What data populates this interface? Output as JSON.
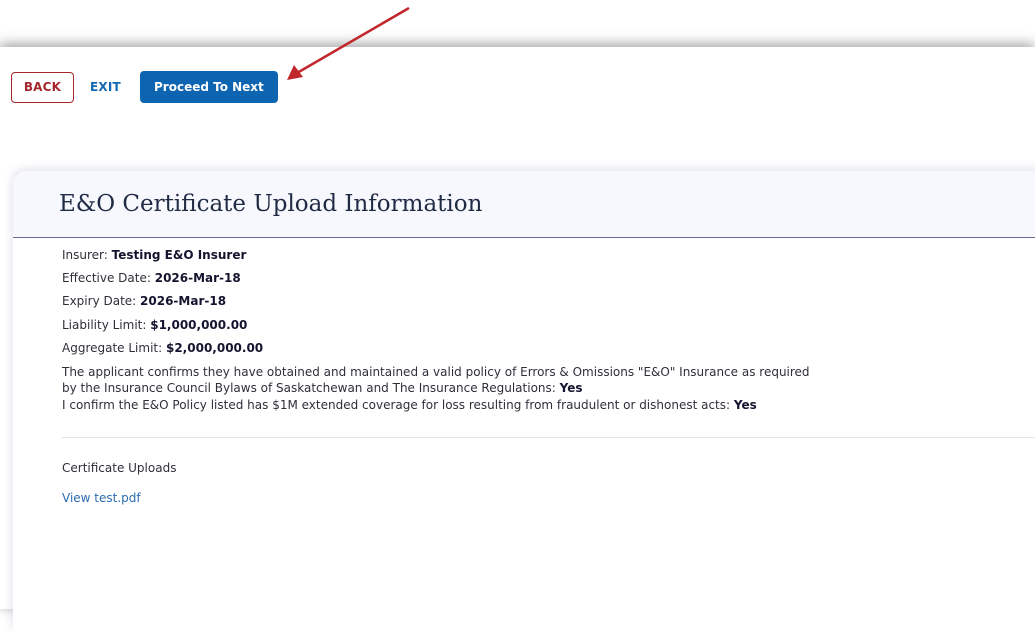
{
  "toolbar": {
    "back_label": "BACK",
    "exit_label": "EXIT",
    "next_label": "Proceed To Next"
  },
  "card": {
    "title": "E&O Certificate Upload Information",
    "insurer_label": "Insurer: ",
    "insurer_value": "Testing E&O Insurer",
    "effective_label": "Effective Date: ",
    "effective_value": "2026-Mar-18",
    "expiry_label": "Expiry Date: ",
    "expiry_value": "2026-Mar-18",
    "liability_label": "Liability Limit: ",
    "liability_value": "$1,000,000.00",
    "aggregate_label": "Aggregate Limit: ",
    "aggregate_value": "$2,000,000.00",
    "confirm1_text": "The applicant confirms they have obtained and maintained a valid policy of Errors & Omissions \"E&O\" Insurance as required by the Insurance Council Bylaws of Saskatchewan and The Insurance Regulations: ",
    "confirm1_value": "Yes",
    "confirm2_text": "I confirm the E&O Policy listed has $1M extended coverage for loss resulting from fraudulent or dishonest acts: ",
    "confirm2_value": "Yes",
    "uploads_label": "Certificate Uploads",
    "view_link": "View test.pdf"
  },
  "colors": {
    "primary": "#0d64b0",
    "back_border": "#a4292d",
    "arrow": "#c0262b"
  }
}
